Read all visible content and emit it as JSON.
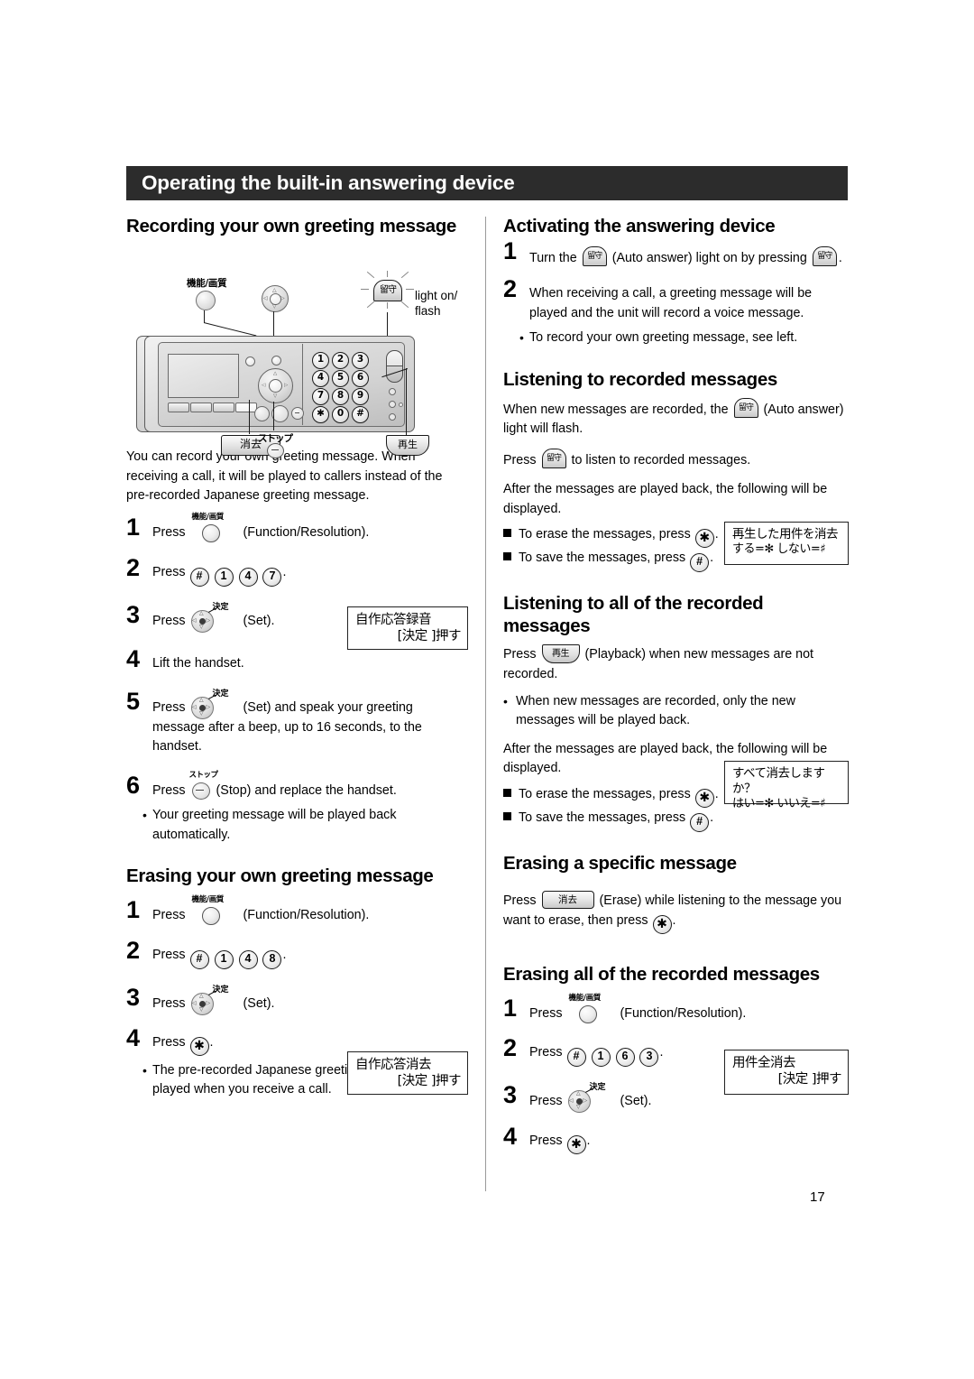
{
  "banner": {
    "title": "Operating the built-in answering device"
  },
  "page_number": "17",
  "device_diagram": {
    "labels": {
      "function_resolution": "機能/画質",
      "rusu": "留守",
      "light_on_flash": "light on/\nflash",
      "shoukyo": "消去",
      "stop": "ストップ",
      "saisei": "再生"
    },
    "keypad": [
      "1",
      "2",
      "3",
      "4",
      "5",
      "6",
      "7",
      "8",
      "9",
      "✱",
      "0",
      "#"
    ]
  },
  "left_column": {
    "section1": {
      "heading": "Recording your own greeting message",
      "intro": "You can record your own greeting message. When receiving a call, it will be played to callers instead of the pre-recorded Japanese greeting message.",
      "steps": [
        {
          "num": "1",
          "pre": "Press",
          "icon": "function-resolution-button",
          "icon_label": "機能/画質",
          "post": "(Function/Resolution)."
        },
        {
          "num": "2",
          "pre": "Press",
          "keys": [
            "#",
            "1",
            "4",
            "7"
          ],
          "post": "."
        },
        {
          "num": "3",
          "pre": "Press",
          "icon": "navigator-set-button",
          "icon_label": "決定",
          "post": "(Set)."
        },
        {
          "num": "4",
          "text": "Lift the handset."
        },
        {
          "num": "5",
          "pre": "Press",
          "icon": "navigator-set-button",
          "icon_label": "決定",
          "post": "(Set) and speak your greeting message after a beep, up to 16 seconds, to the handset."
        },
        {
          "num": "6",
          "pre": "Press",
          "icon": "stop-button",
          "icon_label": "ストップ",
          "post": "(Stop) and replace the handset.",
          "bullet": "Your greeting message will be played back automatically."
        }
      ],
      "lcd": {
        "line1": "自作応答録音",
        "line2": "[決定 ]押す"
      }
    },
    "section2": {
      "heading": "Erasing your own greeting message",
      "steps": [
        {
          "num": "1",
          "pre": "Press",
          "icon": "function-resolution-button",
          "icon_label": "機能/画質",
          "post": "(Function/Resolution)."
        },
        {
          "num": "2",
          "pre": "Press",
          "keys": [
            "#",
            "1",
            "4",
            "8"
          ],
          "post": "."
        },
        {
          "num": "3",
          "pre": "Press",
          "icon": "navigator-set-button",
          "icon_label": "決定",
          "post": "(Set)."
        },
        {
          "num": "4",
          "pre": "Press",
          "keys": [
            "✱"
          ],
          "post": ".",
          "bullet": "The pre-recorded Japanese greeting message will be played when you receive a call."
        }
      ],
      "lcd": {
        "line1": "自作応答消去",
        "line2": "[決定 ]押す"
      }
    }
  },
  "right_column": {
    "section1": {
      "heading": "Activating the answering device",
      "steps": [
        {
          "num": "1",
          "pre": "Turn the",
          "icon": "rusu-auto-answer-button",
          "mid": "(Auto answer) light on by pressing",
          "icon2": "rusu-auto-answer-button",
          "post": "."
        },
        {
          "num": "2",
          "text": "When receiving a call, a greeting message will be played and the unit will record a voice message.",
          "bullet": "To record your own greeting message, see left."
        }
      ]
    },
    "section2": {
      "heading": "Listening to recorded messages",
      "para1_a": "When new messages are recorded, the",
      "para1_b": "(Auto answer) light will flash.",
      "para2_a": "Press",
      "para2_b": "to listen to recorded messages.",
      "para3": "After the messages are played back, the following will be displayed.",
      "item1_a": "To erase the messages, press",
      "item1_b": ".",
      "item2_a": "To save the messages, press",
      "item2_b": ".",
      "lcd": {
        "line1": "再生した用件を消去",
        "line2": "する=✻ しない=♯"
      }
    },
    "section3": {
      "heading": "Listening to all of the recorded messages",
      "para1_a": "Press",
      "para1_b": "(Playback) when new messages are not recorded.",
      "bullet1": "When new messages are recorded, only the new messages will be played back.",
      "para2": "After the messages are played back, the following will be displayed.",
      "item1_a": "To erase the messages, press",
      "item1_b": ".",
      "item2_a": "To save the messages, press",
      "item2_b": ".",
      "lcd": {
        "line1": "すべて消去しますか？",
        "line2": "はい=✻ いいえ=♯"
      }
    },
    "section4": {
      "heading": "Erasing a specific message",
      "para_a": "Press",
      "para_b": "(Erase) while listening to the message you want to erase, then press",
      "para_c": "."
    },
    "section5": {
      "heading": "Erasing all of the recorded messages",
      "steps": [
        {
          "num": "1",
          "pre": "Press",
          "icon": "function-resolution-button",
          "icon_label": "機能/画質",
          "post": "(Function/Resolution)."
        },
        {
          "num": "2",
          "pre": "Press",
          "keys": [
            "#",
            "1",
            "6",
            "3"
          ],
          "post": "."
        },
        {
          "num": "3",
          "pre": "Press",
          "icon": "navigator-set-button",
          "icon_label": "決定",
          "post": "(Set)."
        },
        {
          "num": "4",
          "pre": "Press",
          "keys": [
            "✱"
          ],
          "post": "."
        }
      ],
      "lcd": {
        "line1": "用件全消去",
        "line2": "[決定 ]押す"
      }
    }
  }
}
